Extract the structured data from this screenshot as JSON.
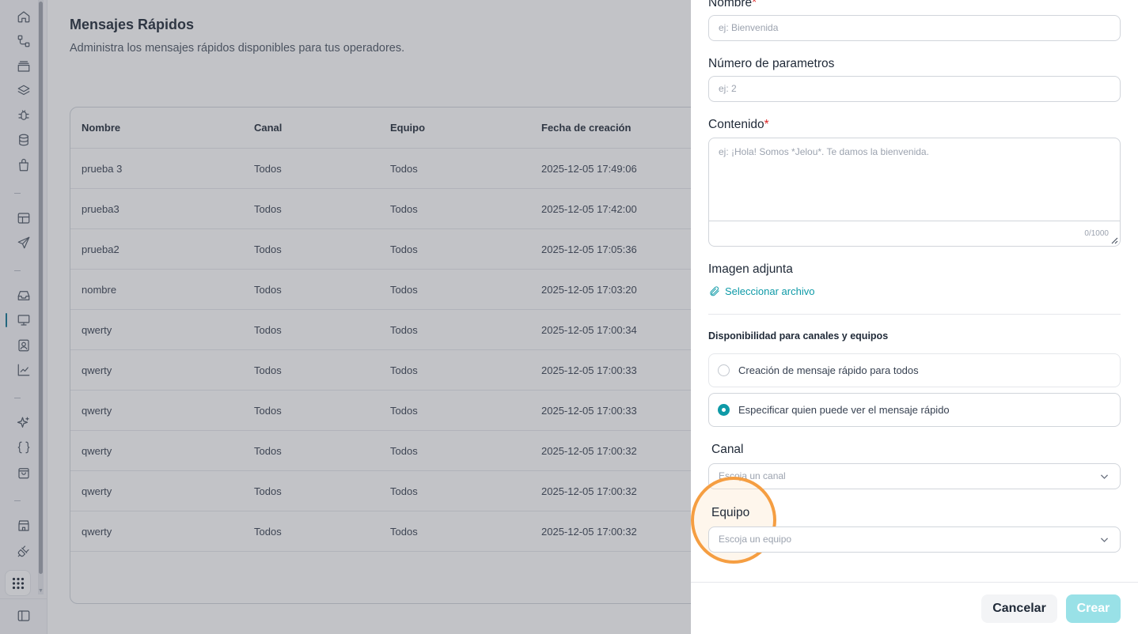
{
  "page": {
    "title": "Mensajes Rápidos",
    "subtitle": "Administra los mensajes rápidos disponibles para tus operadores."
  },
  "table": {
    "columns": [
      "Nombre",
      "Canal",
      "Equipo",
      "Fecha de creación"
    ],
    "rows": [
      [
        "prueba 3",
        "Todos",
        "Todos",
        "2025-12-05 17:49:06"
      ],
      [
        "prueba3",
        "Todos",
        "Todos",
        "2025-12-05 17:42:00"
      ],
      [
        "prueba2",
        "Todos",
        "Todos",
        "2025-12-05 17:05:36"
      ],
      [
        "nombre",
        "Todos",
        "Todos",
        "2025-12-05 17:03:20"
      ],
      [
        "qwerty",
        "Todos",
        "Todos",
        "2025-12-05 17:00:34"
      ],
      [
        "qwerty",
        "Todos",
        "Todos",
        "2025-12-05 17:00:33"
      ],
      [
        "qwerty",
        "Todos",
        "Todos",
        "2025-12-05 17:00:33"
      ],
      [
        "qwerty",
        "Todos",
        "Todos",
        "2025-12-05 17:00:32"
      ],
      [
        "qwerty",
        "Todos",
        "Todos",
        "2025-12-05 17:00:32"
      ],
      [
        "qwerty",
        "Todos",
        "Todos",
        "2025-12-05 17:00:32"
      ]
    ]
  },
  "form": {
    "nombre": {
      "label": "Nombre",
      "required_mark": "*",
      "placeholder": "ej: Bienvenida"
    },
    "parametros": {
      "label": "Número de parametros",
      "placeholder": "ej: 2"
    },
    "contenido": {
      "label": "Contenido",
      "required_mark": "*",
      "placeholder": "ej: ¡Hola! Somos *Jelou*. Te damos la bienvenida.",
      "counter": "0/1000"
    },
    "imagen": {
      "label": "Imagen adjunta",
      "link": "Seleccionar archivo"
    },
    "availability": {
      "title": "Disponibilidad para canales y equipos",
      "options": [
        {
          "label": "Creación de mensaje rápido para todos",
          "selected": false
        },
        {
          "label": "Especificar quien puede ver el mensaje rápido",
          "selected": true
        }
      ]
    },
    "canal": {
      "label": "Canal",
      "placeholder": "Escoja un canal"
    },
    "equipo": {
      "label": "Equipo",
      "placeholder": "Escoja un equipo"
    }
  },
  "footer": {
    "cancel": "Cancelar",
    "create": "Crear"
  },
  "colors": {
    "accent": "#0e9aa7",
    "required": "#dc2626",
    "highlight": "#f59e42",
    "create_disabled": "#99e1e7"
  },
  "sidebar_icons": [
    "home-icon",
    "flow-icon",
    "archive-icon",
    "layers-icon",
    "bug-icon",
    "database-icon",
    "bag-icon",
    "layout-icon",
    "send-icon",
    "inbox-icon",
    "monitor-icon",
    "contact-icon",
    "chart-icon",
    "sparkles-icon",
    "braces-icon",
    "shopping-bag-icon",
    "store-icon",
    "plug-icon",
    "apps-grid-icon",
    "sidebar-toggle-icon"
  ]
}
